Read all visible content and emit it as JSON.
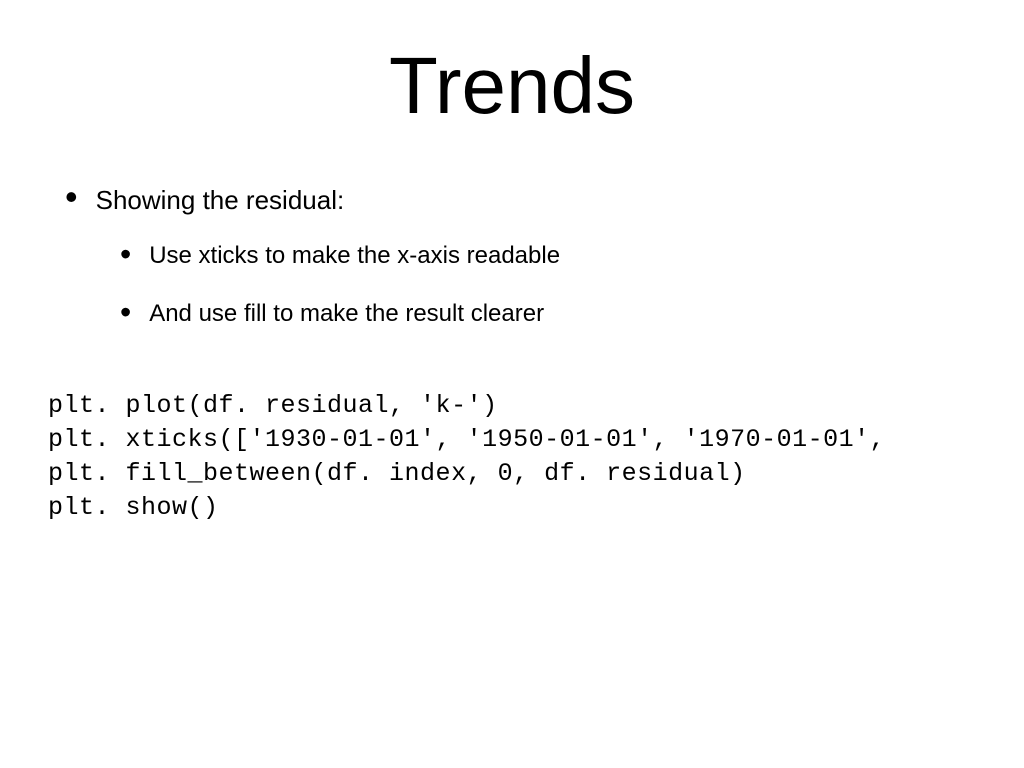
{
  "title": "Trends",
  "bullets": {
    "main": "Showing the residual:",
    "sub1": "Use xticks to make the x-axis readable",
    "sub2": "And use fill to make the result clearer"
  },
  "code": {
    "line1": "plt. plot(df. residual, 'k-')",
    "line2": "plt. xticks(['1930-01-01', '1950-01-01', '1970-01-01',",
    "line3": "plt. fill_between(df. index, 0, df. residual)",
    "line4": "plt. show()"
  }
}
